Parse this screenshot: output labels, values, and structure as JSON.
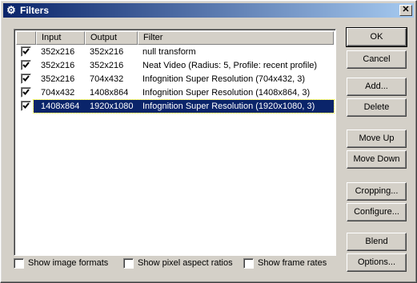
{
  "window": {
    "title": "Filters",
    "close_glyph": "✕"
  },
  "list": {
    "columns": [
      "Input",
      "Output",
      "Filter"
    ],
    "rows": [
      {
        "checked": true,
        "input": "352x216",
        "output": "352x216",
        "filter": "null transform",
        "selected": false
      },
      {
        "checked": true,
        "input": "352x216",
        "output": "352x216",
        "filter": "Neat Video (Radius: 5, Profile: recent profile)",
        "selected": false
      },
      {
        "checked": true,
        "input": "352x216",
        "output": "704x432",
        "filter": "Infognition Super Resolution (704x432, 3)",
        "selected": false
      },
      {
        "checked": true,
        "input": "704x432",
        "output": "1408x864",
        "filter": "Infognition Super Resolution (1408x864, 3)",
        "selected": false
      },
      {
        "checked": true,
        "input": "1408x864",
        "output": "1920x1080",
        "filter": "Infognition Super Resolution (1920x1080, 3)",
        "selected": true
      }
    ]
  },
  "buttons": {
    "ok": "OK",
    "cancel": "Cancel",
    "add": "Add...",
    "delete": "Delete",
    "move_up": "Move Up",
    "move_down": "Move Down",
    "cropping": "Cropping...",
    "configure": "Configure...",
    "blend": "Blend",
    "options": "Options..."
  },
  "checkboxes": {
    "show_image_formats": {
      "label": "Show image formats",
      "checked": false
    },
    "show_pixel_aspect": {
      "label": "Show pixel aspect ratios",
      "checked": false
    },
    "show_frame_rates": {
      "label": "Show frame rates",
      "checked": false
    }
  },
  "icons": {
    "title_icon": "filters-gear-icon"
  }
}
